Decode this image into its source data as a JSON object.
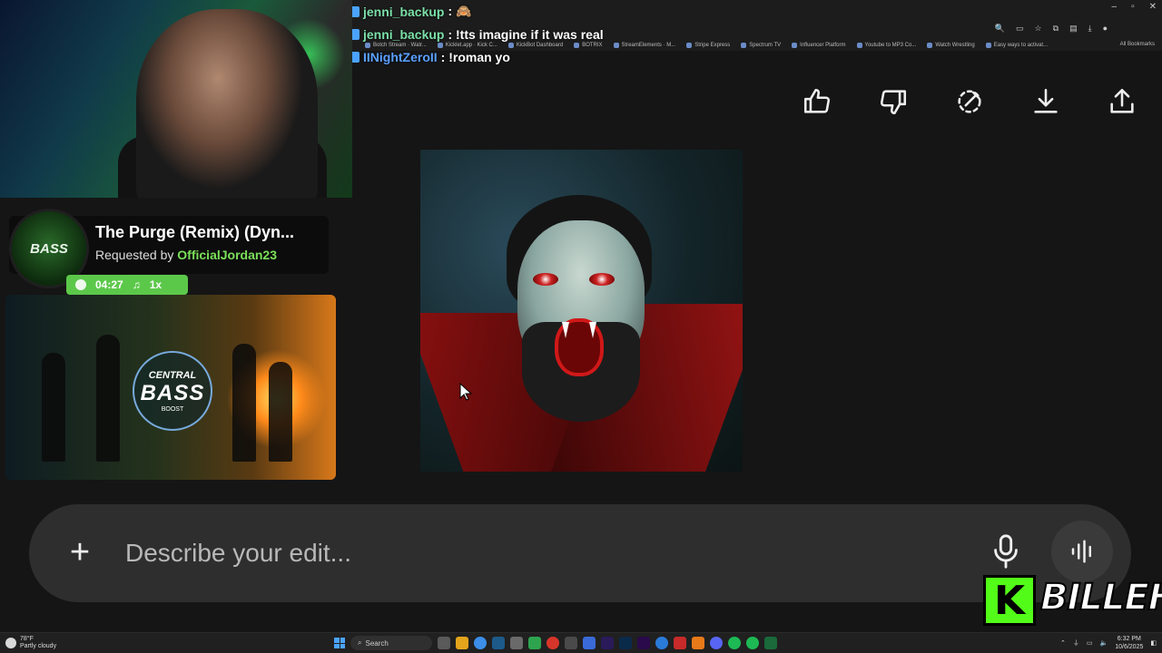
{
  "browser": {
    "window_controls": [
      "–",
      "▫",
      "✕"
    ],
    "bookmarks": [
      "Botch Stream · Watr...",
      "Kicklet.app · Kick C...",
      "KickBot Dashboard",
      "BOTRIX",
      "StreamElements · M...",
      "Stripe Express",
      "Spectrum TV",
      "Influencer Platform",
      "Youtube to MP3 Co...",
      "Watch Wrestling",
      "Easy ways to activat..."
    ],
    "all_bookmarks_label": "All Bookmarks"
  },
  "chat": {
    "messages": [
      {
        "user": "jenni_backup",
        "text": ": 🙈"
      },
      {
        "user": "jenni_backup",
        "text": ": !tts imagine if it was real"
      },
      {
        "user": "IINightZeroII",
        "text": ": !roman yo"
      }
    ]
  },
  "now_playing": {
    "avatar_text": "BASS",
    "title": "The Purge (Remix) (Dyn...",
    "requested_by_label": "Requested by",
    "requester": "OfficialJordan23",
    "duration": "04:27",
    "count": "1x",
    "cover": {
      "logo_top": "CENTRAL",
      "logo_main": "BASS",
      "logo_sub": "BOOST"
    }
  },
  "actions": {
    "like": "thumbs-up-icon",
    "dislike": "thumbs-down-icon",
    "edit": "magic-edit-icon",
    "download": "download-icon",
    "share": "share-icon"
  },
  "editor": {
    "placeholder": "Describe your edit...",
    "plus_label": "+"
  },
  "branding": {
    "k_letter": "K",
    "name": "BILLEH"
  },
  "taskbar": {
    "temperature": "78°F",
    "condition": "Partly cloudy",
    "search_placeholder": "Search",
    "time": "6:32 PM",
    "date": "10/6/2025"
  },
  "colors": {
    "accent_green": "#53fc18",
    "pill_green": "#5cc84a",
    "requester_green": "#7be05a"
  }
}
